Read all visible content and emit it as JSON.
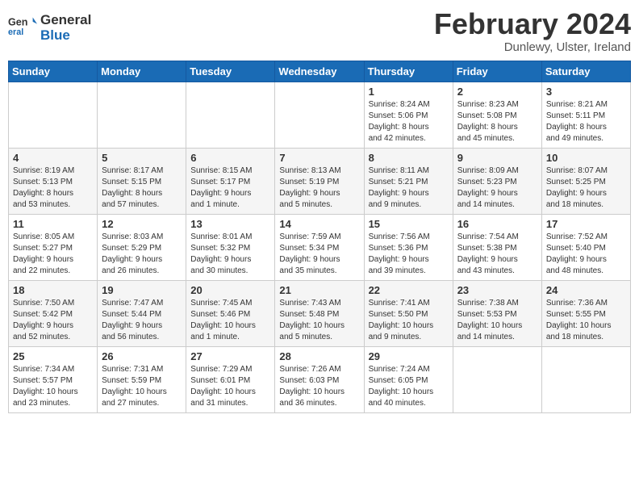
{
  "logo": {
    "line1": "General",
    "line2": "Blue"
  },
  "title": "February 2024",
  "subtitle": "Dunlewy, Ulster, Ireland",
  "days_of_week": [
    "Sunday",
    "Monday",
    "Tuesday",
    "Wednesday",
    "Thursday",
    "Friday",
    "Saturday"
  ],
  "weeks": [
    [
      {
        "num": "",
        "info": ""
      },
      {
        "num": "",
        "info": ""
      },
      {
        "num": "",
        "info": ""
      },
      {
        "num": "",
        "info": ""
      },
      {
        "num": "1",
        "info": "Sunrise: 8:24 AM\nSunset: 5:06 PM\nDaylight: 8 hours\nand 42 minutes."
      },
      {
        "num": "2",
        "info": "Sunrise: 8:23 AM\nSunset: 5:08 PM\nDaylight: 8 hours\nand 45 minutes."
      },
      {
        "num": "3",
        "info": "Sunrise: 8:21 AM\nSunset: 5:11 PM\nDaylight: 8 hours\nand 49 minutes."
      }
    ],
    [
      {
        "num": "4",
        "info": "Sunrise: 8:19 AM\nSunset: 5:13 PM\nDaylight: 8 hours\nand 53 minutes."
      },
      {
        "num": "5",
        "info": "Sunrise: 8:17 AM\nSunset: 5:15 PM\nDaylight: 8 hours\nand 57 minutes."
      },
      {
        "num": "6",
        "info": "Sunrise: 8:15 AM\nSunset: 5:17 PM\nDaylight: 9 hours\nand 1 minute."
      },
      {
        "num": "7",
        "info": "Sunrise: 8:13 AM\nSunset: 5:19 PM\nDaylight: 9 hours\nand 5 minutes."
      },
      {
        "num": "8",
        "info": "Sunrise: 8:11 AM\nSunset: 5:21 PM\nDaylight: 9 hours\nand 9 minutes."
      },
      {
        "num": "9",
        "info": "Sunrise: 8:09 AM\nSunset: 5:23 PM\nDaylight: 9 hours\nand 14 minutes."
      },
      {
        "num": "10",
        "info": "Sunrise: 8:07 AM\nSunset: 5:25 PM\nDaylight: 9 hours\nand 18 minutes."
      }
    ],
    [
      {
        "num": "11",
        "info": "Sunrise: 8:05 AM\nSunset: 5:27 PM\nDaylight: 9 hours\nand 22 minutes."
      },
      {
        "num": "12",
        "info": "Sunrise: 8:03 AM\nSunset: 5:29 PM\nDaylight: 9 hours\nand 26 minutes."
      },
      {
        "num": "13",
        "info": "Sunrise: 8:01 AM\nSunset: 5:32 PM\nDaylight: 9 hours\nand 30 minutes."
      },
      {
        "num": "14",
        "info": "Sunrise: 7:59 AM\nSunset: 5:34 PM\nDaylight: 9 hours\nand 35 minutes."
      },
      {
        "num": "15",
        "info": "Sunrise: 7:56 AM\nSunset: 5:36 PM\nDaylight: 9 hours\nand 39 minutes."
      },
      {
        "num": "16",
        "info": "Sunrise: 7:54 AM\nSunset: 5:38 PM\nDaylight: 9 hours\nand 43 minutes."
      },
      {
        "num": "17",
        "info": "Sunrise: 7:52 AM\nSunset: 5:40 PM\nDaylight: 9 hours\nand 48 minutes."
      }
    ],
    [
      {
        "num": "18",
        "info": "Sunrise: 7:50 AM\nSunset: 5:42 PM\nDaylight: 9 hours\nand 52 minutes."
      },
      {
        "num": "19",
        "info": "Sunrise: 7:47 AM\nSunset: 5:44 PM\nDaylight: 9 hours\nand 56 minutes."
      },
      {
        "num": "20",
        "info": "Sunrise: 7:45 AM\nSunset: 5:46 PM\nDaylight: 10 hours\nand 1 minute."
      },
      {
        "num": "21",
        "info": "Sunrise: 7:43 AM\nSunset: 5:48 PM\nDaylight: 10 hours\nand 5 minutes."
      },
      {
        "num": "22",
        "info": "Sunrise: 7:41 AM\nSunset: 5:50 PM\nDaylight: 10 hours\nand 9 minutes."
      },
      {
        "num": "23",
        "info": "Sunrise: 7:38 AM\nSunset: 5:53 PM\nDaylight: 10 hours\nand 14 minutes."
      },
      {
        "num": "24",
        "info": "Sunrise: 7:36 AM\nSunset: 5:55 PM\nDaylight: 10 hours\nand 18 minutes."
      }
    ],
    [
      {
        "num": "25",
        "info": "Sunrise: 7:34 AM\nSunset: 5:57 PM\nDaylight: 10 hours\nand 23 minutes."
      },
      {
        "num": "26",
        "info": "Sunrise: 7:31 AM\nSunset: 5:59 PM\nDaylight: 10 hours\nand 27 minutes."
      },
      {
        "num": "27",
        "info": "Sunrise: 7:29 AM\nSunset: 6:01 PM\nDaylight: 10 hours\nand 31 minutes."
      },
      {
        "num": "28",
        "info": "Sunrise: 7:26 AM\nSunset: 6:03 PM\nDaylight: 10 hours\nand 36 minutes."
      },
      {
        "num": "29",
        "info": "Sunrise: 7:24 AM\nSunset: 6:05 PM\nDaylight: 10 hours\nand 40 minutes."
      },
      {
        "num": "",
        "info": ""
      },
      {
        "num": "",
        "info": ""
      }
    ]
  ]
}
